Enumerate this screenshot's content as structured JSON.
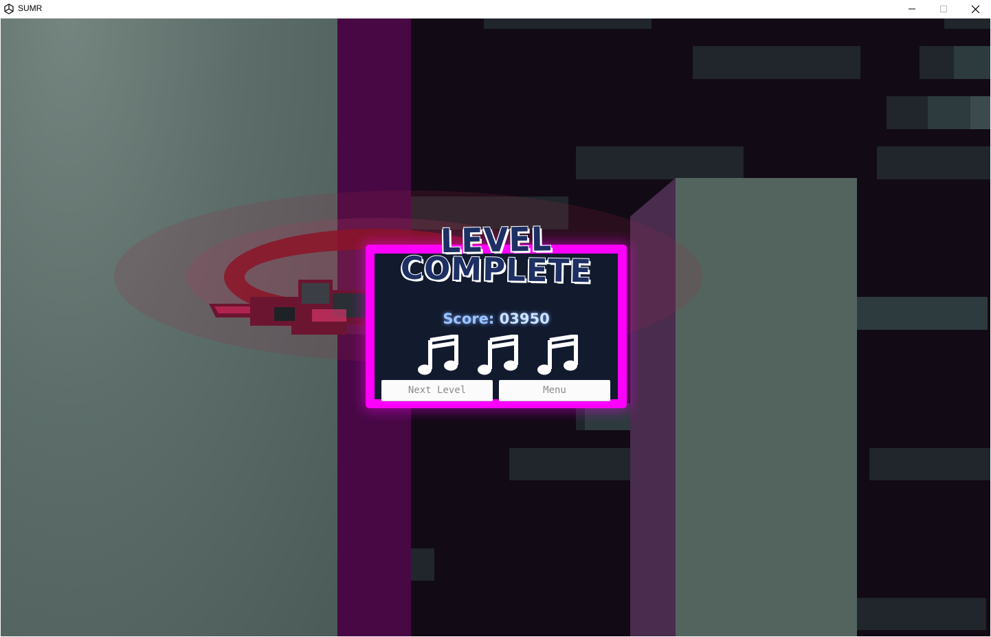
{
  "window": {
    "title": "SUMR",
    "controls": [
      "minimize",
      "maximize",
      "close"
    ]
  },
  "dialog": {
    "title_line1": "LEVEL",
    "title_line2": "COMPLETE",
    "score_label": "Score:",
    "score_value": "03950",
    "notes_earned": 3,
    "buttons": {
      "next_level": "Next Level",
      "menu": "Menu"
    }
  },
  "colors": {
    "accent_magenta": "#ff00ff",
    "dialog_bg": "#121a2e",
    "title_blue": "#1d2f63",
    "purple_strip": "#470844"
  },
  "icons": [
    "unity-logo-icon",
    "minimize-icon",
    "maximize-icon",
    "close-icon",
    "music-note-icon"
  ]
}
